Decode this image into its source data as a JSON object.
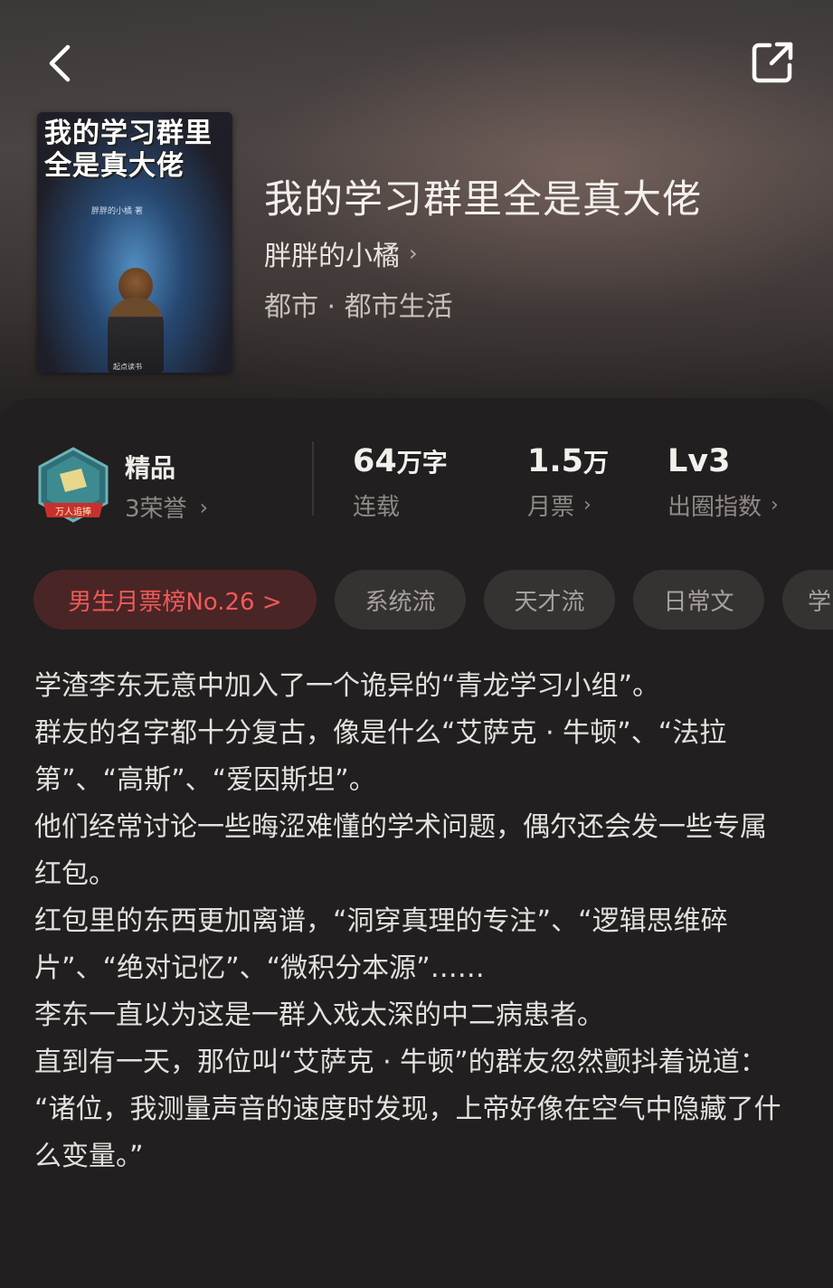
{
  "header": {
    "back_icon": "back-chevron-icon",
    "share_icon": "share-icon"
  },
  "book": {
    "cover_title": "我的学习群里全是真大佬",
    "cover_author": "胖胖的小橘 著",
    "cover_publisher": "起点读书",
    "title": "我的学习群里全是真大佬",
    "author": "胖胖的小橘",
    "genre": "都市 · 都市生活"
  },
  "stats": {
    "grade": "精品",
    "honors": "3荣誉",
    "word_count": "64",
    "word_unit": "万字",
    "status": "连载",
    "monthly_votes": "1.5",
    "monthly_votes_unit": "万",
    "monthly_votes_label": "月票",
    "level": "Lv3",
    "level_label": "出圈指数",
    "badge_text": "万人追捧"
  },
  "tags": [
    {
      "label": "男生月票榜No.26 >"
    },
    {
      "label": "系统流"
    },
    {
      "label": "天才流"
    },
    {
      "label": "日常文"
    },
    {
      "label": "学"
    }
  ],
  "synopsis": [
    "学渣李东无意中加入了一个诡异的“青龙学习小组”。",
    "群友的名字都十分复古，像是什么“艾萨克 · 牛顿”、“法拉第”、“高斯”、“爱因斯坦”。",
    "他们经常讨论一些晦涩难懂的学术问题，偶尔还会发一些专属红包。",
    "红包里的东西更加离谱，“洞穿真理的专注”、“逻辑思维碎片”、“绝对记忆”、“微积分本源”……",
    "李东一直以为这是一群入戏太深的中二病患者。",
    "直到有一天，那位叫“艾萨克 · 牛顿”的群友忽然颤抖着说道：",
    "“诸位，我测量声音的速度时发现，上帝好像在空气中隐藏了什么变量。”"
  ],
  "colors": {
    "background": "#211f1f",
    "rank_tag_bg": "#4a2526",
    "rank_tag_text": "#f05a58",
    "tag_bg": "#353232"
  }
}
